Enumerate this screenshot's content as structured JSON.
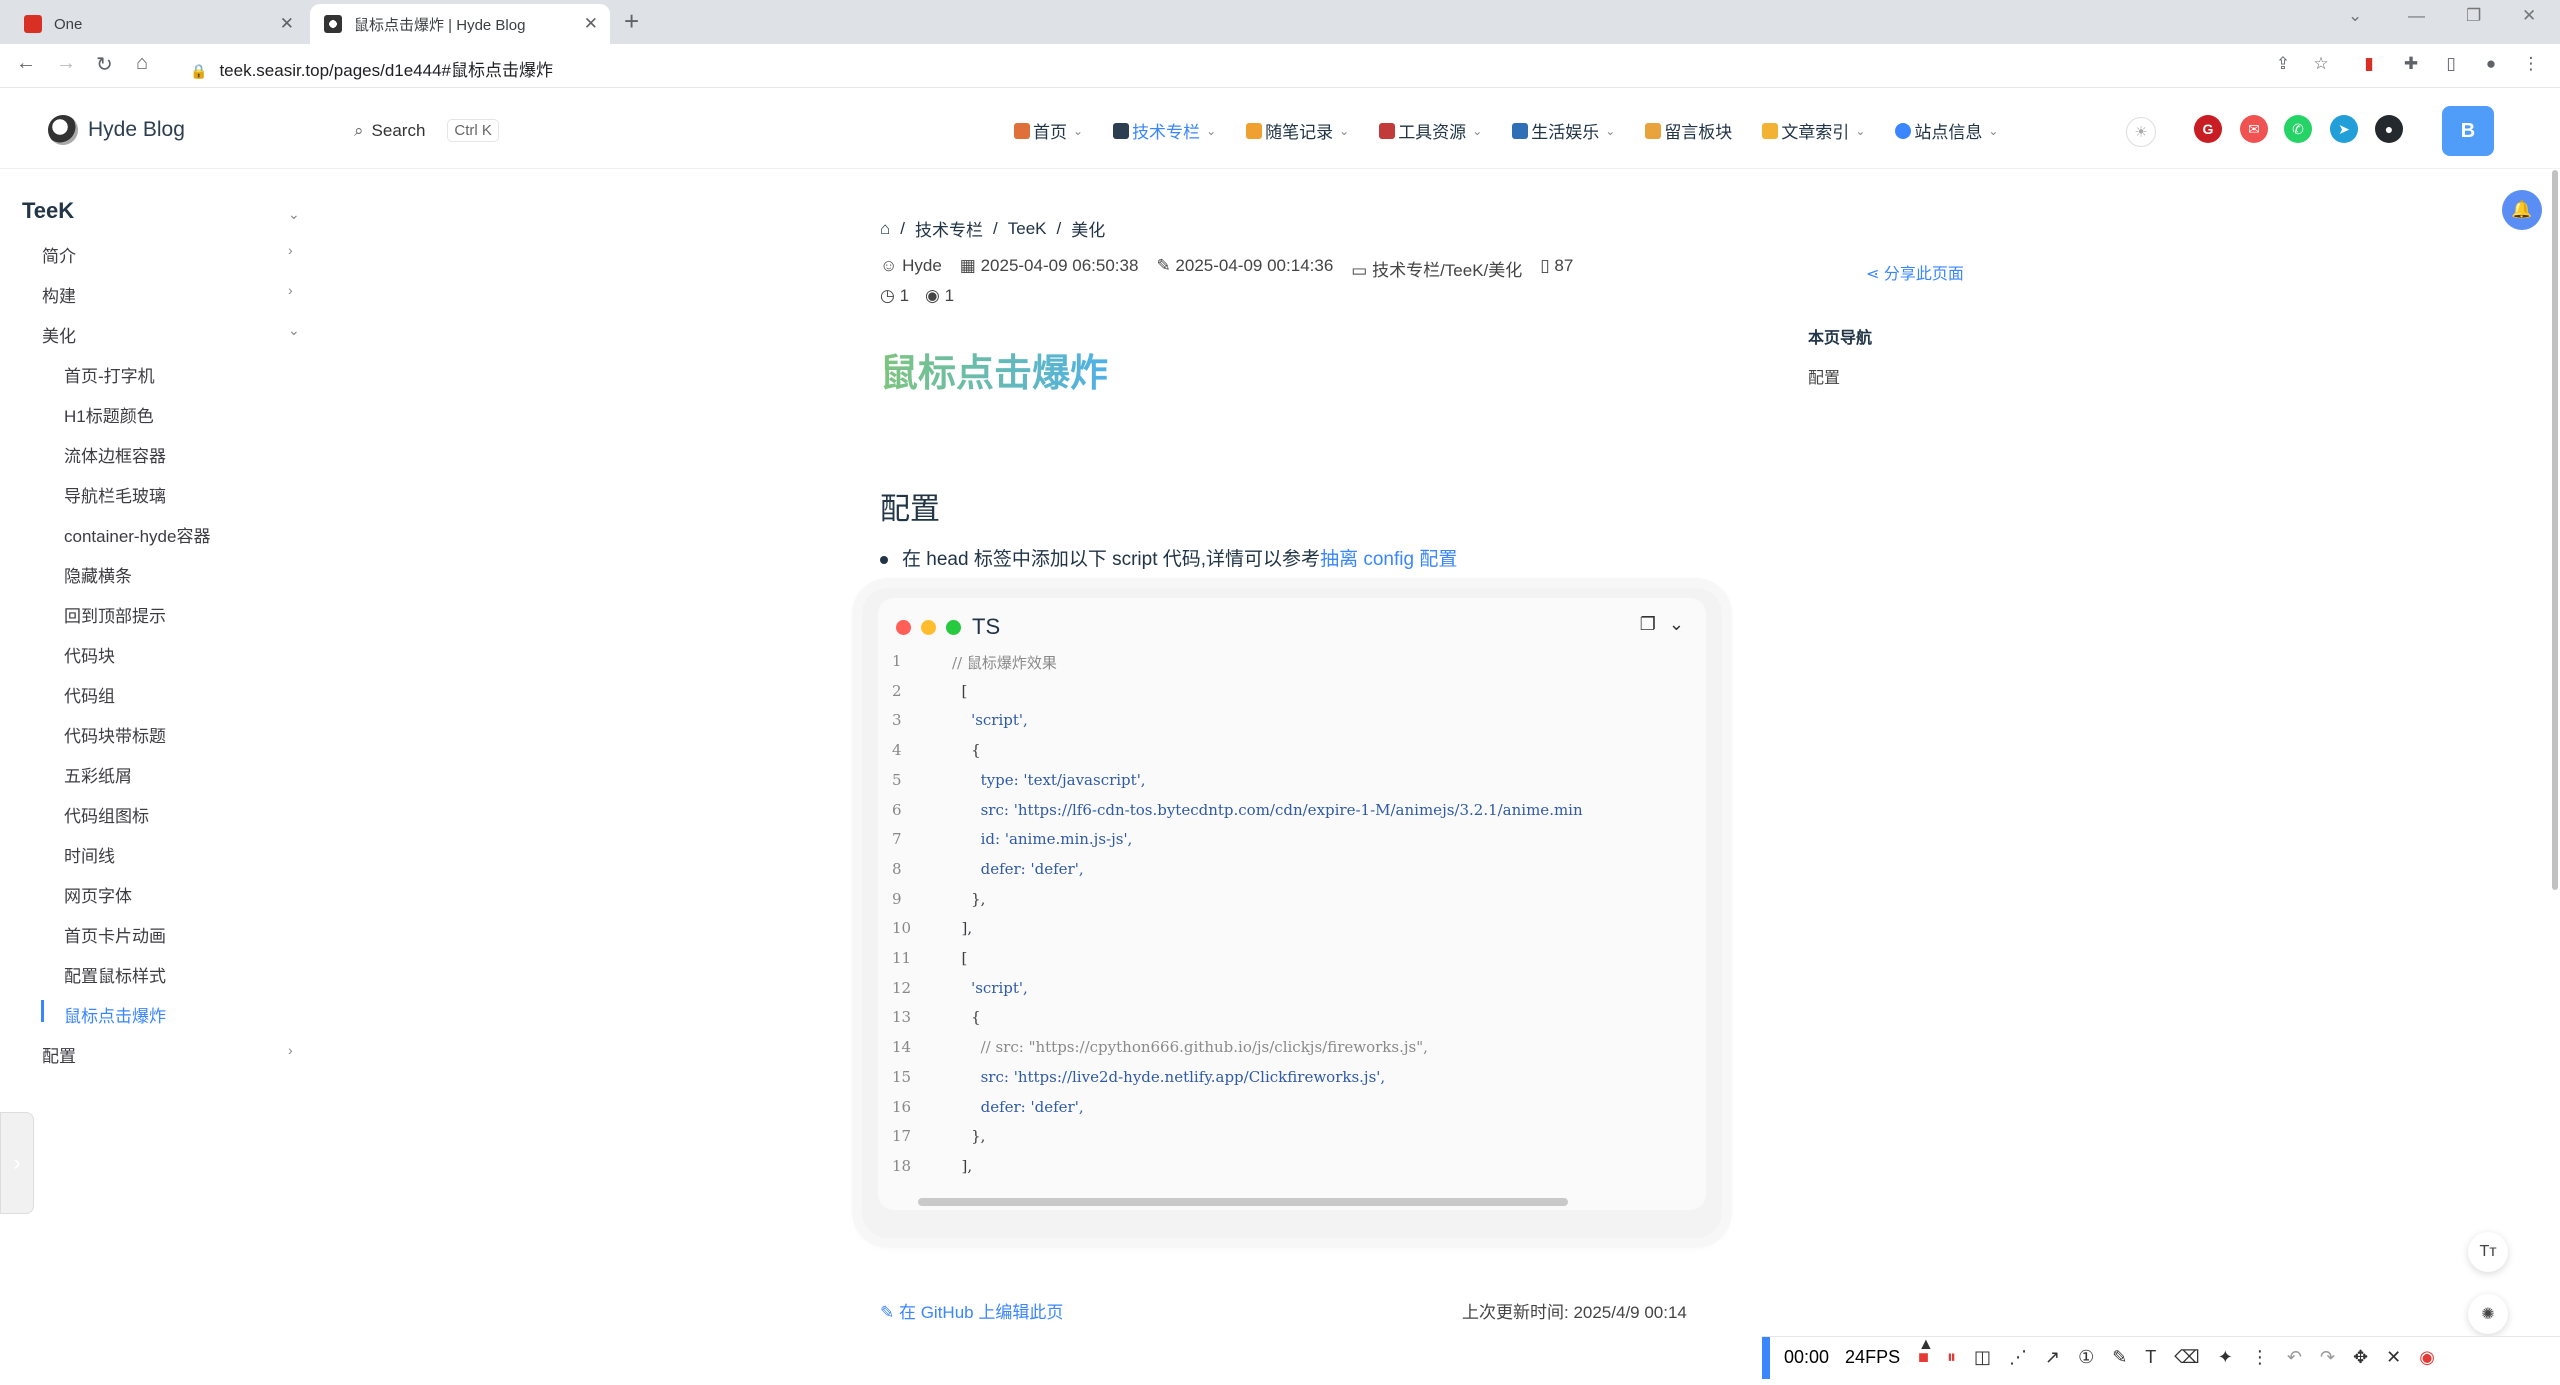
{
  "browser": {
    "tabs": [
      {
        "title": "One",
        "active": false
      },
      {
        "title": "鼠标点击爆炸 | Hyde Blog",
        "active": true
      }
    ],
    "url": "teek.seasir.top/pages/d1e444#鼠标点击爆炸",
    "new_tab": "+",
    "close": "✕"
  },
  "header": {
    "site_name": "Hyde Blog",
    "search_label": "Search",
    "search_shortcut": "Ctrl K",
    "menu": [
      {
        "label": "首页",
        "active": false,
        "icon_color": "#e0703a"
      },
      {
        "label": "技术专栏",
        "active": true,
        "icon_color": "#2c3e50"
      },
      {
        "label": "随笔记录",
        "active": false,
        "icon_color": "#f0a030"
      },
      {
        "label": "工具资源",
        "active": false,
        "icon_color": "#c33a3a"
      },
      {
        "label": "生活娱乐",
        "active": false,
        "icon_color": "#2f6fb5"
      },
      {
        "label": "留言板块",
        "active": false,
        "icon_color": "#e8a33c"
      },
      {
        "label": "文章索引",
        "active": false,
        "icon_color": "#f2b233"
      },
      {
        "label": "站点信息",
        "active": false,
        "icon_color": "#3a86ff"
      }
    ],
    "avatar_letter": "B",
    "social": [
      {
        "name": "gitee",
        "color": "#c71d23",
        "glyph": "G"
      },
      {
        "name": "email",
        "color": "#f05252",
        "glyph": "✉"
      },
      {
        "name": "whatsapp",
        "color": "#25d366",
        "glyph": "✆"
      },
      {
        "name": "telegram",
        "color": "#229ed9",
        "glyph": "➤"
      },
      {
        "name": "github",
        "color": "#24292e",
        "glyph": "●"
      }
    ]
  },
  "sidebar": {
    "group_title": "TeeK",
    "sections": [
      {
        "label": "简介",
        "expanded": false
      },
      {
        "label": "构建",
        "expanded": false
      },
      {
        "label": "美化",
        "expanded": true
      }
    ],
    "children": [
      "首页-打字机",
      "H1标题颜色",
      "流体边框容器",
      "导航栏毛玻璃",
      "container-hyde容器",
      "隐藏横条",
      "回到顶部提示",
      "代码块",
      "代码组",
      "代码块带标题",
      "五彩纸屑",
      "代码组图标",
      "时间线",
      "网页字体",
      "首页卡片动画",
      "配置鼠标样式",
      "鼠标点击爆炸"
    ],
    "active_child": "鼠标点击爆炸",
    "last_section": "配置"
  },
  "article": {
    "breadcrumb": [
      "技术专栏",
      "TeeK",
      "美化"
    ],
    "author": "Hyde",
    "created": "2025-04-09 06:50:38",
    "updated": "2025-04-09 00:14:36",
    "category_path": "技术专栏/TeeK/美化",
    "word_count": "87",
    "reading_time": "1",
    "views": "1",
    "share": "分享此页面",
    "title": "鼠标点击爆炸",
    "h2": "配置",
    "bullet_text": "在 head 标签中添加以下 script 代码,详情可以参考",
    "bullet_link": "抽离 config 配置",
    "edit_link": "在 GitHub 上编辑此页",
    "last_updated": "上次更新时间: 2025/4/9 00:14"
  },
  "toc": {
    "title": "本页导航",
    "items": [
      "配置"
    ]
  },
  "code": {
    "lang": "TS",
    "lines": [
      {
        "n": "1",
        "text": "// 鼠标爆炸效果",
        "kind": "comment"
      },
      {
        "n": "2",
        "text": "  [",
        "kind": "plain"
      },
      {
        "n": "3",
        "text": "    'script',",
        "kind": "str"
      },
      {
        "n": "4",
        "text": "    {",
        "kind": "plain"
      },
      {
        "n": "5",
        "text": "      type: 'text/javascript',",
        "kind": "str"
      },
      {
        "n": "6",
        "text": "      src: 'https://lf6-cdn-tos.bytecdntp.com/cdn/expire-1-M/animejs/3.2.1/anime.min",
        "kind": "str"
      },
      {
        "n": "7",
        "text": "      id: 'anime.min.js-js',",
        "kind": "str"
      },
      {
        "n": "8",
        "text": "      defer: 'defer',",
        "kind": "str"
      },
      {
        "n": "9",
        "text": "    },",
        "kind": "plain"
      },
      {
        "n": "10",
        "text": "  ],",
        "kind": "plain"
      },
      {
        "n": "11",
        "text": "  [",
        "kind": "plain"
      },
      {
        "n": "12",
        "text": "    'script',",
        "kind": "str"
      },
      {
        "n": "13",
        "text": "    {",
        "kind": "plain"
      },
      {
        "n": "14",
        "text": "      // src: \"https://cpython666.github.io/js/clickjs/fireworks.js\",",
        "kind": "comment"
      },
      {
        "n": "15",
        "text": "      src: 'https://live2d-hyde.netlify.app/Clickfireworks.js',",
        "kind": "str"
      },
      {
        "n": "16",
        "text": "      defer: 'defer',",
        "kind": "str"
      },
      {
        "n": "17",
        "text": "    },",
        "kind": "plain"
      },
      {
        "n": "18",
        "text": "  ],",
        "kind": "plain"
      }
    ]
  },
  "recorder": {
    "time": "00:00",
    "fps": "24FPS"
  }
}
